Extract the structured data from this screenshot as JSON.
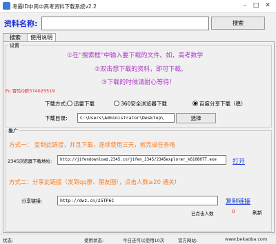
{
  "window": {
    "title": "考霸ID中高中高考资料下载系统v2.2",
    "minimize_icon": "minimize-icon",
    "maximize_icon": "maximize-icon",
    "close_icon": "close-icon"
  },
  "search": {
    "label": "资料名称:",
    "value": "",
    "button_label": "搜索"
  },
  "tabs": [
    {
      "label": "搜索"
    },
    {
      "label": "使用说明"
    }
  ],
  "settings": {
    "group_title": "设置",
    "instructions": [
      "①在“搜索框”中输入要下载的文件。如，高考数学",
      "②双击想下载的资料，即可下载。",
      "③下载的时候请耐心等待！"
    ],
    "qq_text": "Fu 冒险Q群374025519",
    "download_method_label": "下载方式:",
    "radio_options": [
      {
        "label": "迅雷下载",
        "selected": false
      },
      {
        "label": "360安全浏览器下载",
        "selected": false
      },
      {
        "label": "百度分享下载（稳）",
        "selected": true
      }
    ],
    "dir_label": "下载目录:",
    "dir_value": "C:\\Users\\Administrator\\Desktop\\",
    "select_button": "选择"
  },
  "promo": {
    "group_title": "推广",
    "method1": "方式一：  复制此链接，并且下载，连续使用三天，就完成任务咯",
    "browser_label": "2345浏览器下载地址:",
    "browser_url": "http://jifendownload.2345.cn/jifen_2345/2345explorer_k610807T.exe",
    "open_link": "打开",
    "method2": "方式二：分享此链接（发到qq群、朋友圈），点击人数≥20 通关!",
    "share_label": "分享链接:",
    "share_url": "http://dwz.cn/25TP6C",
    "copy_link": "复制链接",
    "clicks_label": "已点击人数",
    "clicks_value": "0",
    "refresh_label": "刷新"
  },
  "statusbar": {
    "status_label": "状态:",
    "uses_label": "使用状态:",
    "today_label": "今日还可以使用10次",
    "site_label": "官方网站:",
    "site_url": "www.bekaoba.com"
  }
}
